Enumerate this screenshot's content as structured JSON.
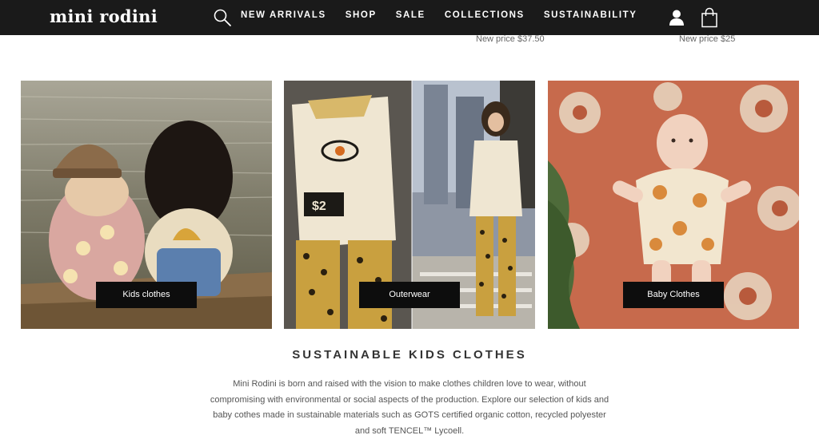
{
  "brand": {
    "name": "mini rodini"
  },
  "header": {
    "search_icon": "search-icon",
    "account_icon": "user-icon",
    "cart_icon": "shopping-bag-icon"
  },
  "nav": {
    "items": [
      {
        "label": "NEW ARRIVALS"
      },
      {
        "label": "SHOP"
      },
      {
        "label": "SALE"
      },
      {
        "label": "COLLECTIONS"
      },
      {
        "label": "SUSTAINABILITY"
      }
    ]
  },
  "products": [
    {
      "new_price": "New price $37.50"
    },
    {
      "new_price": "New price $25"
    }
  ],
  "categories": [
    {
      "label": "Kids clothes"
    },
    {
      "label": "Outerwear"
    },
    {
      "label": "Baby Clothes"
    }
  ],
  "sustainable": {
    "title": "SUSTAINABLE KIDS CLOTHES",
    "lines": [
      "Mini Rodini is born and raised with the vision to make clothes children love to wear, without",
      "compromising with environmental or social aspects of the production. Explore our selection of kids and",
      "baby cothes made in sustainable materials such as GOTS certified organic cotton, recycled polyester",
      "and soft TENCEL™ Lycoell."
    ]
  },
  "colors": {
    "header_bg": "#1a1a1a",
    "header_text": "#ffffff",
    "label_bg": "#0d0d0d",
    "body_text": "#555555"
  }
}
